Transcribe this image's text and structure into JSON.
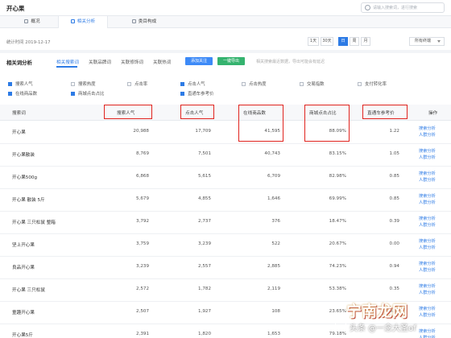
{
  "app": {
    "title": "开心果"
  },
  "search": {
    "placeholder": "请输入搜索词，进行搜索"
  },
  "tabs": [
    {
      "label": "概况"
    },
    {
      "label": "相关分析"
    },
    {
      "label": "类目构成"
    }
  ],
  "stat": {
    "time_label": "统计时间 2019-12-17",
    "periods": [
      "1天",
      "30天",
      "日",
      "周",
      "月"
    ],
    "active_period": "日",
    "terminal": "所有终端"
  },
  "section": {
    "title": "相关词分析",
    "subtabs": [
      "相关搜索词",
      "关联品牌词",
      "关联修饰词",
      "关联热词"
    ],
    "active_subtab": "相关搜索词",
    "btn_add": "添加关注",
    "btn_export": "一键导出",
    "hint": "相关搜索最近数据，导出可能会有延迟"
  },
  "metrics": {
    "row1": [
      {
        "label": "搜索人气",
        "checked": true
      },
      {
        "label": "搜索热度",
        "checked": false
      },
      {
        "label": "点击率",
        "checked": false
      },
      {
        "label": "点击人气",
        "checked": true
      },
      {
        "label": "点击热度",
        "checked": false
      },
      {
        "label": "交易指数",
        "checked": false
      },
      {
        "label": "支付转化率",
        "checked": false
      }
    ],
    "row2": [
      {
        "label": "在线商品数",
        "checked": true
      },
      {
        "label": "商城点击占比",
        "checked": true
      },
      {
        "label": "直通车参考价",
        "checked": true
      }
    ]
  },
  "table": {
    "headers": {
      "keyword": "搜索词",
      "search_pop": "搜索人气",
      "click_pop": "点击人气",
      "online_items": "在线商品数",
      "mall_click": "商城点击占比",
      "ztc_price": "直通车参考价",
      "ops": "操作"
    },
    "ops_labels": {
      "trend": "搜索分析",
      "portrait": "人群分析"
    },
    "rows": [
      {
        "keyword": "开心果",
        "search_pop": "20,988",
        "click_pop": "17,709",
        "online_items": "41,595",
        "mall_click": "88.09%",
        "ztc_price": "1.22"
      },
      {
        "keyword": "开心果散装",
        "search_pop": "8,769",
        "click_pop": "7,501",
        "online_items": "40,743",
        "mall_click": "83.15%",
        "ztc_price": "1.05"
      },
      {
        "keyword": "开心果500g",
        "search_pop": "6,868",
        "click_pop": "5,615",
        "online_items": "6,709",
        "mall_click": "82.98%",
        "ztc_price": "0.85"
      },
      {
        "keyword": "开心果 散装 5斤",
        "search_pop": "5,679",
        "click_pop": "4,855",
        "online_items": "1,646",
        "mall_click": "69.99%",
        "ztc_price": "0.85"
      },
      {
        "keyword": "开心果 三只松鼠 整箱",
        "search_pop": "3,792",
        "click_pop": "2,737",
        "online_items": "376",
        "mall_click": "18.47%",
        "ztc_price": "0.39"
      },
      {
        "keyword": "坚上开心果",
        "search_pop": "3,759",
        "click_pop": "3,239",
        "online_items": "522",
        "mall_click": "20.67%",
        "ztc_price": "0.00"
      },
      {
        "keyword": "良品开心果",
        "search_pop": "3,239",
        "click_pop": "2,557",
        "online_items": "2,885",
        "mall_click": "74.23%",
        "ztc_price": "0.94"
      },
      {
        "keyword": "开心果 三只松鼠",
        "search_pop": "2,572",
        "click_pop": "1,782",
        "online_items": "2,119",
        "mall_click": "53.38%",
        "ztc_price": "0.35"
      },
      {
        "keyword": "童趣开心果",
        "search_pop": "2,507",
        "click_pop": "1,927",
        "online_items": "108",
        "mall_click": "23.65%",
        "ztc_price": "0.48"
      },
      {
        "keyword": "开心果5斤",
        "search_pop": "2,391",
        "click_pop": "1,820",
        "online_items": "1,653",
        "mall_click": "79.18%",
        "ztc_price": ""
      }
    ]
  },
  "watermark": {
    "big": "宁南龙网",
    "small": "头条 @一念大圣of"
  }
}
